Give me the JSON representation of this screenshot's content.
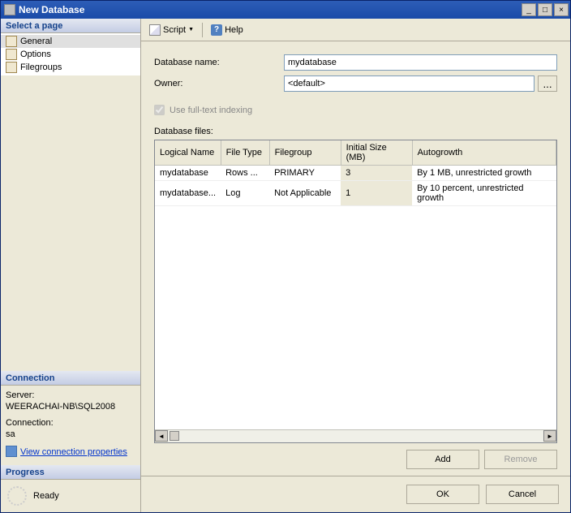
{
  "window": {
    "title": "New Database"
  },
  "sidebar": {
    "select_page_header": "Select a page",
    "pages": [
      {
        "label": "General",
        "selected": true
      },
      {
        "label": "Options",
        "selected": false
      },
      {
        "label": "Filegroups",
        "selected": false
      }
    ],
    "connection_header": "Connection",
    "server_label": "Server:",
    "server_value": "WEERACHAI-NB\\SQL2008",
    "connection_label": "Connection:",
    "connection_value": "sa",
    "view_conn_props": "View connection properties",
    "progress_header": "Progress",
    "progress_status": "Ready"
  },
  "toolbar": {
    "script_label": "Script",
    "help_label": "Help"
  },
  "form": {
    "db_name_label": "Database name:",
    "db_name_value": "mydatabase",
    "owner_label": "Owner:",
    "owner_value": "<default>",
    "browse_label": "...",
    "fulltext_label": "Use full-text indexing",
    "files_label": "Database files:",
    "columns": {
      "logical_name": "Logical Name",
      "file_type": "File Type",
      "filegroup": "Filegroup",
      "initial_size": "Initial Size (MB)",
      "autogrowth": "Autogrowth"
    },
    "rows": [
      {
        "logical_name": "mydatabase",
        "file_type": "Rows ...",
        "filegroup": "PRIMARY",
        "initial_size": "3",
        "autogrowth": "By 1 MB, unrestricted growth"
      },
      {
        "logical_name": "mydatabase...",
        "file_type": "Log",
        "filegroup": "Not Applicable",
        "initial_size": "1",
        "autogrowth": "By 10 percent, unrestricted growth"
      }
    ],
    "add_label": "Add",
    "remove_label": "Remove"
  },
  "footer": {
    "ok_label": "OK",
    "cancel_label": "Cancel"
  }
}
